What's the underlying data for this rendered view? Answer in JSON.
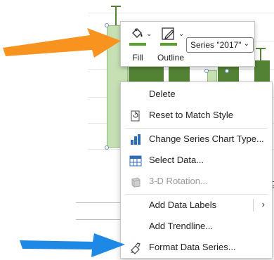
{
  "mini_toolbar": {
    "fill": {
      "label": "Fill",
      "icon": "paint-bucket-icon",
      "color": "#5aa02c"
    },
    "outline": {
      "label": "Outline",
      "icon": "pen-outline-icon",
      "color": "#5aa02c"
    },
    "series_selector": {
      "value": "Series \"2017\""
    }
  },
  "context_menu": {
    "items": [
      {
        "label": "Delete",
        "icon": null,
        "enabled": true
      },
      {
        "label": "Reset to Match Style",
        "icon": "reset-style-icon",
        "enabled": true
      },
      {
        "label": "Change Series Chart Type...",
        "icon": "chart-type-icon",
        "enabled": true
      },
      {
        "label": "Select Data...",
        "icon": "select-data-icon",
        "enabled": true
      },
      {
        "label": "3-D Rotation...",
        "icon": "rotation-3d-icon",
        "enabled": false
      },
      {
        "label": "Add Data Labels",
        "icon": null,
        "enabled": true,
        "has_submenu": true
      },
      {
        "label": "Add Trendline...",
        "icon": null,
        "enabled": true
      },
      {
        "label": "Format Data Series...",
        "icon": "format-series-icon",
        "enabled": true
      }
    ]
  },
  "annotations": {
    "orange_arrow_color": "#f7931e",
    "blue_arrow_color": "#1e88e5"
  },
  "background": {
    "stray_text": "g"
  }
}
